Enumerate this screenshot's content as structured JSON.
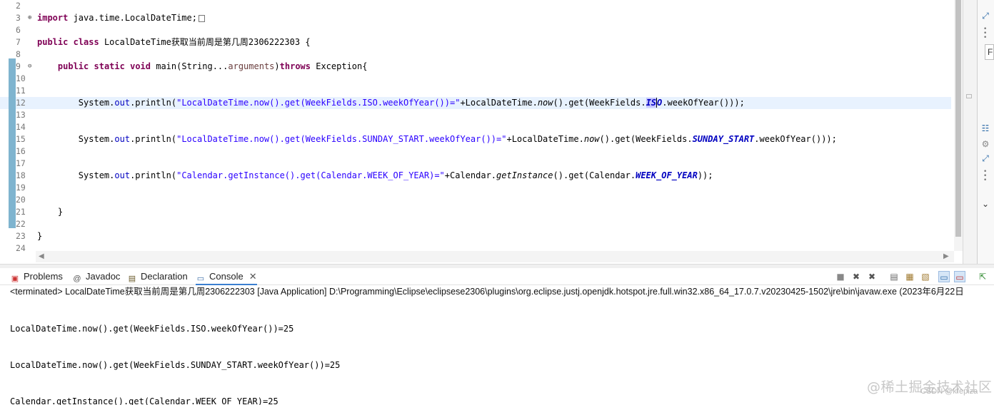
{
  "editor": {
    "lines": [
      {
        "n": "2",
        "tokens": []
      },
      {
        "n": "3",
        "fold": "⊕",
        "tokens": [
          [
            "kw",
            "import"
          ],
          [
            "t",
            " java.time.LocalDateTime;"
          ]
        ],
        "collapsed": true
      },
      {
        "n": "6",
        "tokens": []
      },
      {
        "n": "7",
        "tokens": [
          [
            "kw",
            "public"
          ],
          [
            "t",
            " "
          ],
          [
            "kw",
            "class"
          ],
          [
            "t",
            " LocalDateTime获取当前周是第几周2306222303 {"
          ]
        ]
      },
      {
        "n": "8",
        "tokens": []
      },
      {
        "n": "9",
        "fold": "⊖",
        "tokens": [
          [
            "t",
            "    "
          ],
          [
            "kw",
            "public"
          ],
          [
            "t",
            " "
          ],
          [
            "kw",
            "static"
          ],
          [
            "t",
            " "
          ],
          [
            "kw",
            "void"
          ],
          [
            "t",
            " main(String..."
          ],
          [
            "param",
            "arguments"
          ],
          [
            "t",
            ")"
          ],
          [
            "kw",
            "throws"
          ],
          [
            "t",
            " Exception{"
          ]
        ]
      },
      {
        "n": "10",
        "tokens": []
      },
      {
        "n": "11",
        "tokens": []
      },
      {
        "n": "12",
        "current": true,
        "tokens": [
          [
            "t",
            "        System."
          ],
          [
            "fld",
            "out"
          ],
          [
            "t",
            ".println("
          ],
          [
            "str",
            "\"LocalDateTime.now().get(WeekFields.ISO.weekOfYear())=\""
          ],
          [
            "t",
            "+LocalDateTime."
          ],
          [
            "ital",
            "now"
          ],
          [
            "t",
            "().get(WeekFields."
          ],
          [
            "selsfld",
            "IS"
          ],
          [
            "caretsfld",
            "O"
          ],
          [
            "t",
            ".weekOfYear()));"
          ]
        ]
      },
      {
        "n": "13",
        "tokens": []
      },
      {
        "n": "14",
        "tokens": []
      },
      {
        "n": "15",
        "tokens": [
          [
            "t",
            "        System."
          ],
          [
            "fld",
            "out"
          ],
          [
            "t",
            ".println("
          ],
          [
            "str",
            "\"LocalDateTime.now().get(WeekFields.SUNDAY_START.weekOfYear())=\""
          ],
          [
            "t",
            "+LocalDateTime."
          ],
          [
            "ital",
            "now"
          ],
          [
            "t",
            "().get(WeekFields."
          ],
          [
            "sfld",
            "SUNDAY_START"
          ],
          [
            "t",
            ".weekOfYear()));"
          ]
        ]
      },
      {
        "n": "16",
        "tokens": []
      },
      {
        "n": "17",
        "tokens": []
      },
      {
        "n": "18",
        "tokens": [
          [
            "t",
            "        System."
          ],
          [
            "fld",
            "out"
          ],
          [
            "t",
            ".println("
          ],
          [
            "str",
            "\"Calendar.getInstance().get(Calendar.WEEK_OF_YEAR)=\""
          ],
          [
            "t",
            "+Calendar."
          ],
          [
            "ital",
            "getInstance"
          ],
          [
            "t",
            "().get(Calendar."
          ],
          [
            "sfld",
            "WEEK_OF_YEAR"
          ],
          [
            "t",
            "));"
          ]
        ]
      },
      {
        "n": "19",
        "tokens": []
      },
      {
        "n": "20",
        "tokens": []
      },
      {
        "n": "21",
        "tokens": [
          [
            "t",
            "    }"
          ]
        ]
      },
      {
        "n": "22",
        "tokens": []
      },
      {
        "n": "23",
        "tokens": [
          [
            "t",
            "}"
          ]
        ]
      },
      {
        "n": "24",
        "tokens": []
      }
    ]
  },
  "right_rail": {
    "find_field_value": "Fi"
  },
  "views": {
    "tabs": [
      {
        "label": "Problems",
        "icon": "problems-icon"
      },
      {
        "label": "Javadoc",
        "icon": "javadoc-icon"
      },
      {
        "label": "Declaration",
        "icon": "declaration-icon"
      },
      {
        "label": "Console",
        "icon": "console-icon",
        "active": true
      }
    ],
    "close_glyph": "✕"
  },
  "console": {
    "launch_description": "<terminated> LocalDateTime获取当前周是第几周2306222303 [Java Application] D:\\Programming\\Eclipse\\eclipsese2306\\plugins\\org.eclipse.justj.openjdk.hotspot.jre.full.win32.x86_64_17.0.7.v20230425-1502\\jre\\bin\\javaw.exe  (2023年6月22日",
    "output": [
      "LocalDateTime.now().get(WeekFields.ISO.weekOfYear())=25",
      "LocalDateTime.now().get(WeekFields.SUNDAY_START.weekOfYear())=25",
      "Calendar.getInstance().get(Calendar.WEEK_OF_YEAR)=25"
    ]
  },
  "watermark": {
    "main": "@稀土掘金技术社区",
    "sub": "CSDN @kfepiza"
  },
  "colors": {
    "keyword": "#7f0055",
    "string": "#2a00ff",
    "field": "#0000c0",
    "current_line": "#e8f2fe",
    "active_tab_accent": "#3b7fd0"
  }
}
